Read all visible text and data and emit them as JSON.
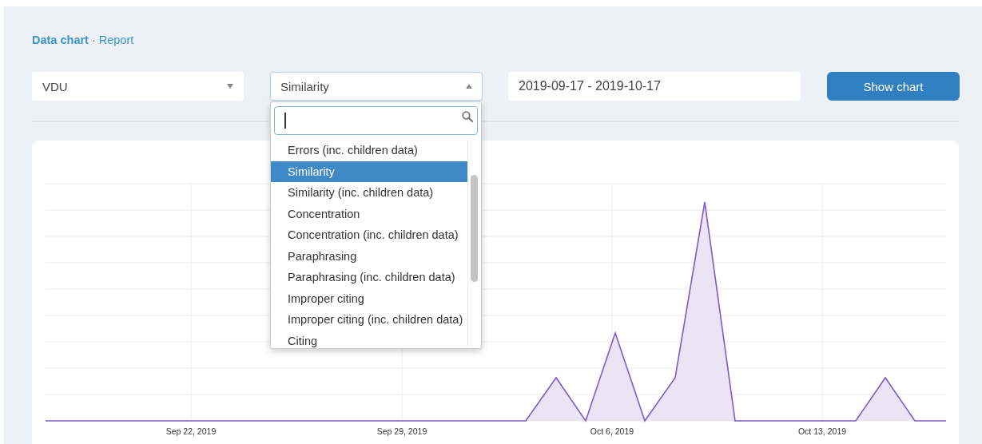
{
  "breadcrumb": {
    "separator": "·",
    "items": [
      {
        "label": "Data chart",
        "selected": true
      },
      {
        "label": "Report",
        "selected": false
      }
    ]
  },
  "filters": {
    "source": {
      "value": "VDU",
      "expanded": false
    },
    "metric": {
      "value": "Similarity",
      "expanded": true,
      "options": [
        {
          "label": "Errors (inc. children data)",
          "selected": false
        },
        {
          "label": "Similarity",
          "selected": true
        },
        {
          "label": "Similarity (inc. children data)",
          "selected": false
        },
        {
          "label": "Concentration",
          "selected": false
        },
        {
          "label": "Concentration (inc. children data)",
          "selected": false
        },
        {
          "label": "Paraphrasing",
          "selected": false
        },
        {
          "label": "Paraphrasing (inc. children data)",
          "selected": false
        },
        {
          "label": "Improper citing",
          "selected": false
        },
        {
          "label": "Improper citing (inc. children data)",
          "selected": false
        },
        {
          "label": "Citing",
          "selected": false
        }
      ]
    },
    "date_range": {
      "value": "2019-09-17 - 2019-10-17"
    },
    "button": "Show chart"
  },
  "chart": {
    "x_axis_labels": [
      "Sep 22, 2019",
      "Sep 29, 2019",
      "Oct 6, 2019",
      "Oct 13, 2019"
    ]
  }
}
